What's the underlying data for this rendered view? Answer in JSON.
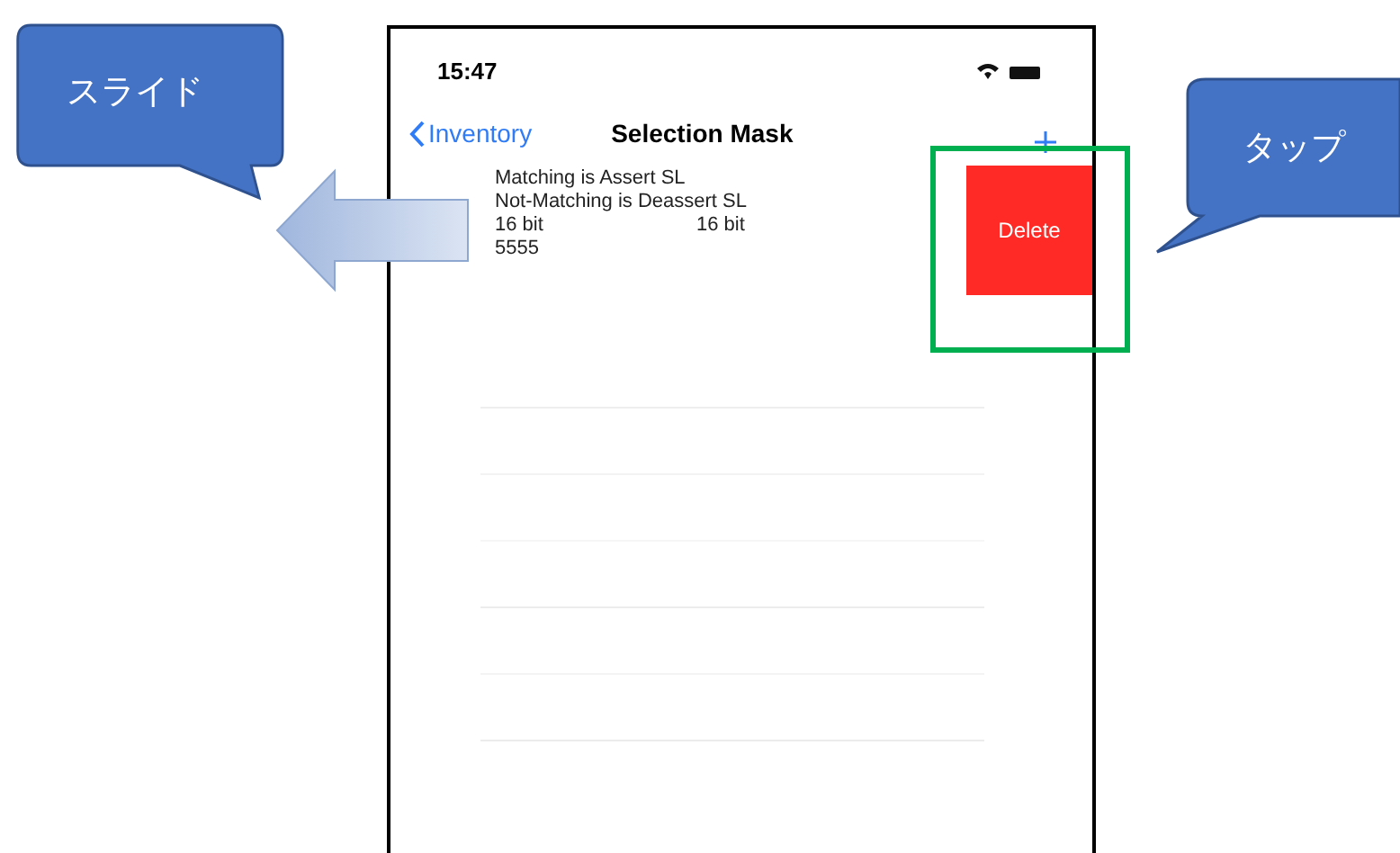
{
  "callouts": [
    {
      "kind": "slide",
      "text": "スライド"
    },
    {
      "kind": "tap",
      "text": "タップ"
    }
  ],
  "status_bar": {
    "time": "15:47"
  },
  "nav": {
    "back": "Inventory",
    "title": "Selection Mask"
  },
  "rows": [
    {
      "line_1": "Matching is Assert SL",
      "line_2": "Not-Matching is Deassert SL",
      "column_1": "16 bit",
      "column_2": "16 bit",
      "line_4": "5555",
      "action": "Delete"
    }
  ]
}
